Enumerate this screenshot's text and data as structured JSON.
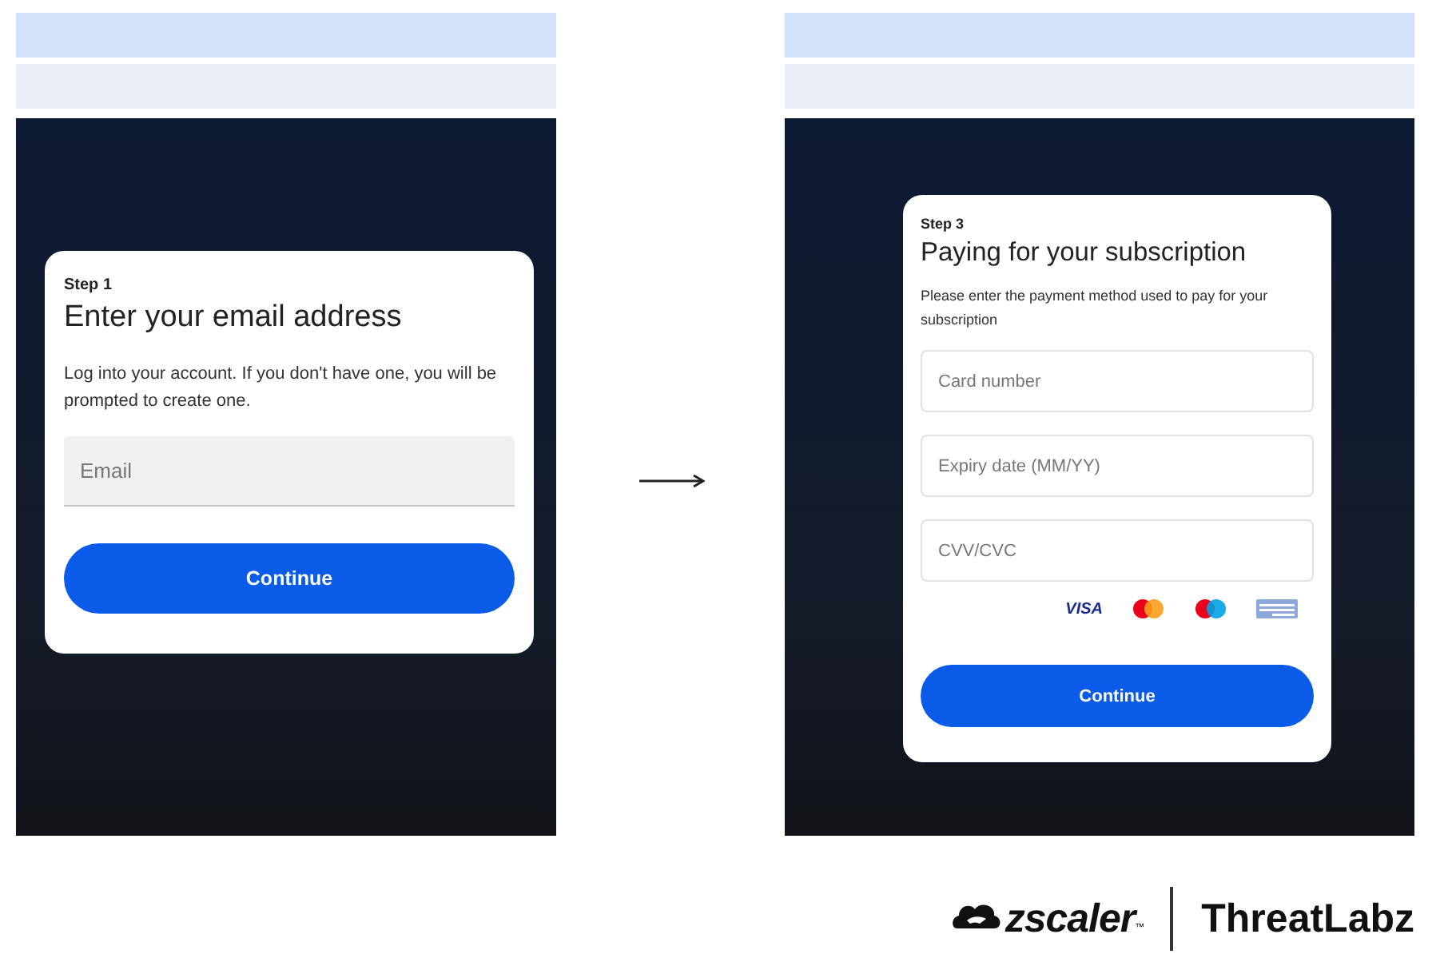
{
  "screens": [
    {
      "step": "Step 1",
      "title": "Enter your email address",
      "description": "Log into your account. If you don't have one, you will be prompted to create one.",
      "fields": [
        {
          "kind": "filled",
          "placeholder": "Email"
        }
      ],
      "button": "Continue"
    },
    {
      "step": "Step 3",
      "title": "Paying for your subscription",
      "description": "Please enter the payment method used to pay for your subscription",
      "fields": [
        {
          "kind": "outlined",
          "placeholder": "Card number"
        },
        {
          "kind": "outlined",
          "placeholder": "Expiry date (MM/YY)"
        },
        {
          "kind": "outlined",
          "placeholder": "CVV/CVC"
        }
      ],
      "payment_icons": [
        {
          "kind": "visa",
          "label": "VISA"
        },
        {
          "kind": "mastercard"
        },
        {
          "kind": "maestro"
        },
        {
          "kind": "amex"
        }
      ],
      "button": "Continue"
    }
  ],
  "logo": {
    "brand": "zscaler",
    "trademark": "™",
    "product": "ThreatLabz"
  }
}
